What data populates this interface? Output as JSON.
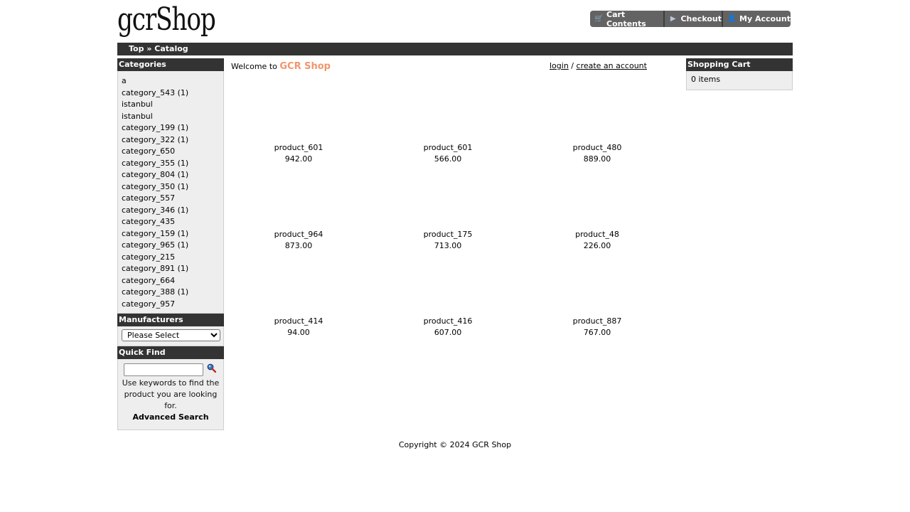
{
  "header": {
    "logo": "gcrShop",
    "nav": {
      "cart_contents": "Cart Contents",
      "checkout": "Checkout",
      "my_account": "My Account"
    }
  },
  "breadcrumb": {
    "top": "Top",
    "separator": "»",
    "catalog": "Catalog"
  },
  "categories": {
    "title": "Categories",
    "items": [
      "a",
      "category_543 (1)",
      "istanbul",
      "istanbul",
      "category_199 (1)",
      "category_322 (1)",
      "category_650",
      "category_355 (1)",
      "category_804 (1)",
      "category_350 (1)",
      "category_557",
      "category_346 (1)",
      "category_435",
      "category_159 (1)",
      "category_965 (1)",
      "category_215",
      "category_891 (1)",
      "category_664",
      "category_388 (1)",
      "category_957"
    ]
  },
  "manufacturers": {
    "title": "Manufacturers",
    "selected": "Please Select"
  },
  "quick_find": {
    "title": "Quick Find",
    "input_value": "",
    "help": "Use keywords to find the product you are looking for.",
    "advanced": "Advanced Search"
  },
  "welcome": {
    "prefix": "Welcome to",
    "shop_name": "GCR Shop",
    "login": "login",
    "separator": "/",
    "create_account": "create an account"
  },
  "products": [
    {
      "name": "product_601",
      "price": "942.00"
    },
    {
      "name": "product_601",
      "price": "566.00"
    },
    {
      "name": "product_480",
      "price": "889.00"
    },
    {
      "name": "product_964",
      "price": "873.00"
    },
    {
      "name": "product_175",
      "price": "713.00"
    },
    {
      "name": "product_48",
      "price": "226.00"
    },
    {
      "name": "product_414",
      "price": "94.00"
    },
    {
      "name": "product_416",
      "price": "607.00"
    },
    {
      "name": "product_887",
      "price": "767.00"
    }
  ],
  "shopping_cart": {
    "title": "Shopping Cart",
    "summary": "0 items"
  },
  "footer": {
    "copyright": "Copyright © 2024 GCR Shop"
  },
  "colors": {
    "bar": "#333333",
    "nav_button": "#636363",
    "accent": "#f0966d",
    "box_background": "#eeeeee"
  }
}
